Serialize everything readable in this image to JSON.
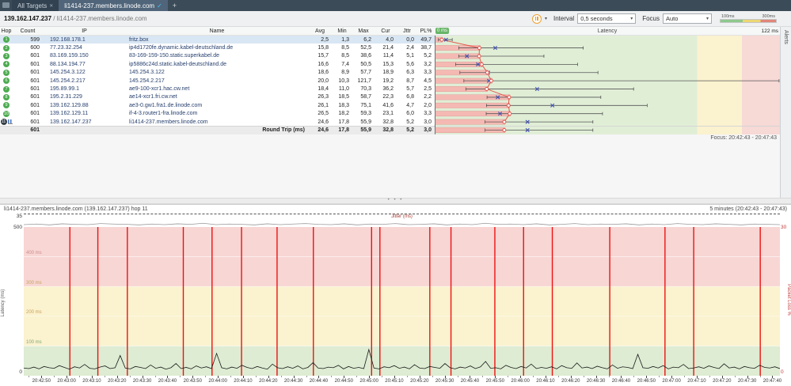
{
  "icons": {
    "close": "✕",
    "check": "✓",
    "caret": "▾",
    "dots": "• • •",
    "plus": "+"
  },
  "tabs": {
    "all_targets": "All Targets",
    "target_tab": "li1414-237.members.linode.com"
  },
  "toolbar": {
    "target_ip": "139.162.147.237",
    "separator": " / ",
    "target_host": "li1414-237.members.linode.com",
    "interval_label": "Interval",
    "interval_value": "0,5 seconds",
    "focus_label": "Focus",
    "focus_value": "Auto",
    "scale_low": "100ms",
    "scale_high": "300ms"
  },
  "table": {
    "headers": {
      "hop": "Hop",
      "count": "Count",
      "ip": "IP",
      "name": "Name",
      "avg": "Avg",
      "min": "Min",
      "max": "Max",
      "cur": "Cur",
      "jttr": "Jttr",
      "pl": "PL%",
      "latency": "Latency",
      "scale_min": "0 ms",
      "scale_max": "122 ms"
    },
    "hops": [
      {
        "hop": "1",
        "count": "599",
        "ip": "192.168.178.1",
        "name": "fritz.box",
        "avg": "2,5",
        "min": "1,3",
        "max": "6,2",
        "cur": "4,0",
        "jttr": "0,0",
        "pl": "49,7",
        "selected": true
      },
      {
        "hop": "2",
        "count": "600",
        "ip": "77.23.32.254",
        "name": "ip4d1720fe.dynamic.kabel-deutschland.de",
        "avg": "15,8",
        "min": "8,5",
        "max": "52,5",
        "cur": "21,4",
        "jttr": "2,4",
        "pl": "38,7"
      },
      {
        "hop": "3",
        "count": "601",
        "ip": "83.169.159.150",
        "name": "83-169-159-150.static.superkabel.de",
        "avg": "15,7",
        "min": "8,5",
        "max": "38,6",
        "cur": "11,4",
        "jttr": "5,1",
        "pl": "5,2"
      },
      {
        "hop": "4",
        "count": "601",
        "ip": "88.134.194.77",
        "name": "ip5886c24d.static.kabel-deutschland.de",
        "avg": "16,6",
        "min": "7,4",
        "max": "50,5",
        "cur": "15,3",
        "jttr": "5,6",
        "pl": "3,2"
      },
      {
        "hop": "5",
        "count": "601",
        "ip": "145.254.3.122",
        "name": "145.254.3.122",
        "avg": "18,6",
        "min": "8,9",
        "max": "57,7",
        "cur": "18,9",
        "jttr": "6,3",
        "pl": "3,3"
      },
      {
        "hop": "6",
        "count": "601",
        "ip": "145.254.2.217",
        "name": "145.254.2.217",
        "avg": "20,0",
        "min": "10,3",
        "max": "121,7",
        "cur": "19,2",
        "jttr": "8,7",
        "pl": "4,5"
      },
      {
        "hop": "7",
        "count": "601",
        "ip": "195.89.99.1",
        "name": "ae9-100-xcr1.hac.cw.net",
        "avg": "18,4",
        "min": "11,0",
        "max": "70,3",
        "cur": "36,2",
        "jttr": "5,7",
        "pl": "2,5"
      },
      {
        "hop": "8",
        "count": "601",
        "ip": "195.2.31.229",
        "name": "ae14-xcr1.fri.cw.net",
        "avg": "26,3",
        "min": "18,5",
        "max": "58,7",
        "cur": "22,3",
        "jttr": "6,8",
        "pl": "2,2"
      },
      {
        "hop": "9",
        "count": "601",
        "ip": "139.162.129.88",
        "name": "ae3-0.gw1.fra1.de.linode.com",
        "avg": "26,1",
        "min": "18,3",
        "max": "75,1",
        "cur": "41,6",
        "jttr": "4,7",
        "pl": "2,0"
      },
      {
        "hop": "10",
        "count": "601",
        "ip": "139.162.129.11",
        "name": "if-4-3.router1-fra.linode.com",
        "avg": "26,5",
        "min": "18,2",
        "max": "59,3",
        "cur": "23,1",
        "jttr": "6,0",
        "pl": "3,3"
      },
      {
        "hop": "11",
        "count": "601",
        "ip": "139.162.147.237",
        "name": "li1414-237.members.linode.com",
        "avg": "24,6",
        "min": "17,8",
        "max": "55,9",
        "cur": "32,8",
        "jttr": "5,2",
        "pl": "3,0",
        "dark": true,
        "graphed": true
      }
    ],
    "round_trip": {
      "count": "601",
      "label": "Round Trip (ms)",
      "avg": "24,6",
      "min": "17,8",
      "max": "55,9",
      "cur": "32,8",
      "jttr": "5,2",
      "pl": "3,0"
    },
    "focus_text": "Focus: 20:42:43 - 20:47:43"
  },
  "alerts_strip": {
    "label": "Alerts"
  },
  "timegraph": {
    "title": "li1414-237.members.linode.com (139.162.147.237) hop 11",
    "range_label": "5 minutes (20:42:43 - 20:47:43)",
    "jitter_label": "Jitter (ms)",
    "jitter_max": "35",
    "lat_axis_max": "500",
    "lat_axis_min": "0",
    "lat_axis_label": "Latency (ms)",
    "pl_axis_max": "30",
    "pl_axis_min": "0",
    "pl_axis_label": "Packet Loss %",
    "gridlines": [
      "400 ms",
      "300 ms",
      "200 ms",
      "100 ms"
    ],
    "x_labels": [
      "20:42:50",
      "20:43:00",
      "20:43:10",
      "20:43:20",
      "20:43:30",
      "20:43:40",
      "20:43:50",
      "20:44:00",
      "20:44:10",
      "20:44:20",
      "20:44:30",
      "20:44:40",
      "20:44:50",
      "20:45:00",
      "20:45:10",
      "20:45:20",
      "20:45:30",
      "20:45:40",
      "20:45:50",
      "20:46:00",
      "20:46:10",
      "20:46:20",
      "20:46:30",
      "20:46:40",
      "20:46:50",
      "20:47:00",
      "20:47:10",
      "20:47:20",
      "20:47:30",
      "20:47:40"
    ],
    "loss_events": [
      0.061,
      0.098,
      0.137,
      0.211,
      0.249,
      0.288,
      0.335,
      0.383,
      0.46,
      0.471,
      0.537,
      0.565,
      0.623,
      0.661,
      0.699,
      0.775,
      0.848,
      0.886,
      0.974
    ],
    "latency_series": [
      26,
      24,
      29,
      23,
      31,
      27,
      25,
      34,
      28,
      22,
      30,
      26,
      38,
      25,
      23,
      29,
      33,
      24,
      27,
      68,
      26,
      23,
      31,
      28,
      24,
      36,
      25,
      29,
      22,
      27,
      41,
      24,
      28,
      23,
      33,
      26,
      30,
      24,
      75,
      27,
      23,
      29,
      25,
      35,
      28,
      24,
      31,
      26,
      22,
      39,
      27,
      24,
      30,
      25,
      33,
      23,
      28,
      44,
      26,
      24,
      29,
      27,
      35,
      23,
      31,
      25,
      28,
      24,
      88,
      26,
      23,
      30,
      27,
      34,
      25,
      29,
      23,
      37,
      26,
      24,
      31,
      28,
      25,
      41,
      27,
      23,
      29,
      26,
      33,
      24,
      30,
      48,
      25,
      27,
      23,
      35,
      28,
      24,
      31,
      26,
      39,
      24,
      28,
      25,
      30,
      23,
      34,
      27,
      25,
      43,
      26,
      29,
      24,
      32,
      27,
      23,
      36,
      25,
      30,
      28,
      24,
      72,
      27,
      25,
      31,
      26,
      34,
      23,
      29,
      27,
      38,
      24,
      26,
      30,
      25,
      33,
      28,
      24,
      40,
      26,
      29,
      23,
      31,
      27,
      25,
      35,
      28,
      26,
      30,
      24
    ],
    "jitter_series": [
      3,
      5,
      2,
      6,
      4,
      3,
      7,
      5,
      4,
      2,
      5,
      3,
      6,
      4,
      8,
      3,
      5,
      4,
      2,
      6,
      3,
      5,
      7,
      4,
      3,
      6,
      2,
      5,
      4,
      7,
      3,
      4,
      6,
      2,
      5,
      3,
      8,
      4,
      5,
      3,
      6,
      2,
      4,
      7,
      3,
      5,
      4,
      6,
      2,
      5,
      3,
      7,
      4,
      3,
      6,
      4,
      2,
      5,
      4,
      3
    ]
  },
  "colors": {
    "accent_orange": "#f0a030",
    "tab_check_blue": "#49c1f2",
    "hop_badge_green": "#4cab50",
    "hop_badge_dark": "#343f46",
    "avg_bar": "#f5b9b3",
    "avg_bar_edge": "#df9d96",
    "avg_line": "#e2574c",
    "cur_mark": "#3f51b5",
    "zone_green": "#ddecd2",
    "zone_yellow": "#fbf2cf",
    "zone_red": "#f7d6d4",
    "loss_red": "#ee1212",
    "glabel_red": "#cf8f8f",
    "glabel_yellow": "#c9a35e",
    "glabel_green": "#83a877",
    "scale_badge_green": "#67b567"
  }
}
